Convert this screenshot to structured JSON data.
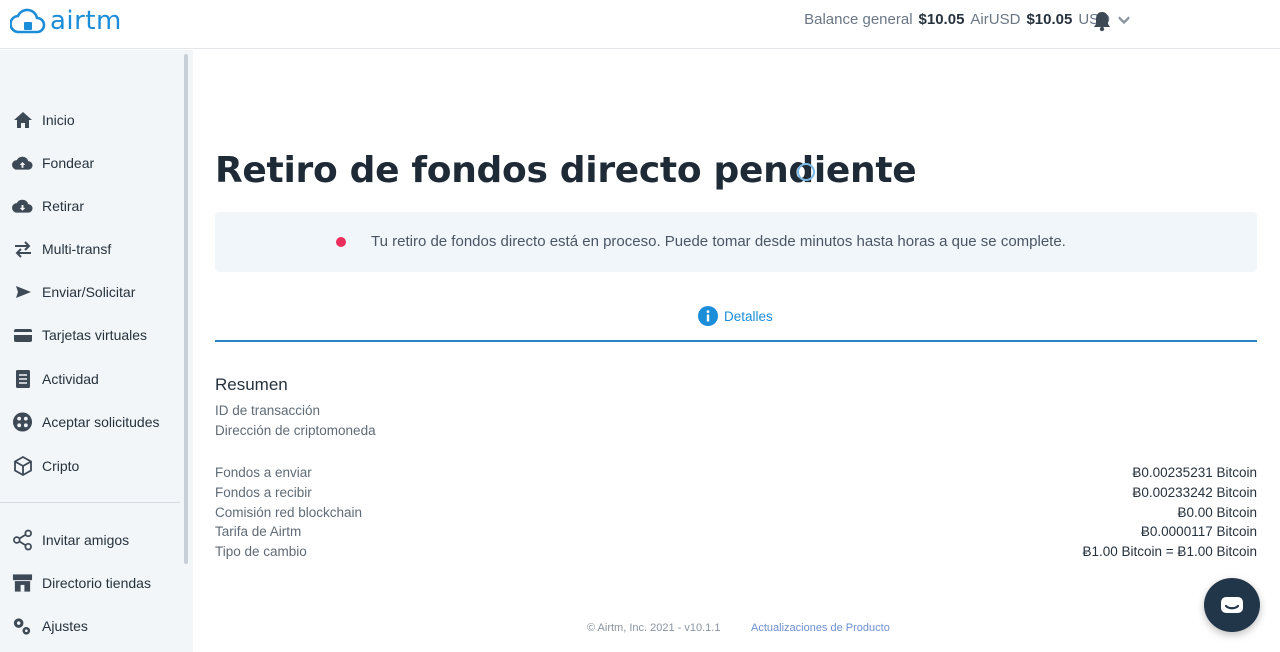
{
  "app": {
    "logo_text": "airtm"
  },
  "header": {
    "balance_label": "Balance general",
    "balance_airusd_value": "$10.05",
    "balance_airusd_unit": "AirUSD",
    "balance_usd_value": "$10.05",
    "balance_usd_unit": "USD"
  },
  "sidebar": {
    "items": [
      {
        "label": "Inicio",
        "icon": "home-icon"
      },
      {
        "label": "Fondear",
        "icon": "cloud-upload-icon"
      },
      {
        "label": "Retirar",
        "icon": "cloud-download-icon"
      },
      {
        "label": "Multi-transf",
        "icon": "transfer-arrows-icon"
      },
      {
        "label": "Enviar/Solicitar",
        "icon": "send-icon"
      },
      {
        "label": "Tarjetas virtuales",
        "icon": "credit-card-icon"
      },
      {
        "label": "Actividad",
        "icon": "document-icon"
      },
      {
        "label": "Aceptar solicitudes",
        "icon": "requests-icon"
      },
      {
        "label": "Cripto",
        "icon": "cube-icon"
      }
    ],
    "bottom_items": [
      {
        "label": "Invitar amigos",
        "icon": "share-icon"
      },
      {
        "label": "Directorio tiendas",
        "icon": "store-icon"
      },
      {
        "label": "Ajustes",
        "icon": "gears-icon"
      }
    ]
  },
  "main": {
    "title": "Retiro de fondos directo pendiente",
    "alert_text": "Tu retiro de fondos directo está en proceso. Puede tomar desde minutos hasta horas a que se complete.",
    "tab_label": "Detalles",
    "summary": {
      "title": "Resumen",
      "id_label": "ID de transacción",
      "address_label": "Dirección de criptomoneda",
      "rows": [
        {
          "label": "Fondos a enviar",
          "value": "Ƀ0.00235231 Bitcoin"
        },
        {
          "label": "Fondos a recibir",
          "value": "Ƀ0.00233242 Bitcoin"
        },
        {
          "label": "Comisión red blockchain",
          "value": "Ƀ0.00 Bitcoin"
        },
        {
          "label": "Tarifa de Airtm",
          "value": "Ƀ0.0000117 Bitcoin"
        },
        {
          "label": "Tipo de cambio",
          "value": "Ƀ1.00 Bitcoin = Ƀ1.00 Bitcoin"
        }
      ]
    }
  },
  "footer": {
    "copyright": "© Airtm, Inc. 2021 - v10.1.1",
    "link": "Actualizaciones de Producto"
  },
  "colors": {
    "brand": "#1c8dd9",
    "status_dot": "#ea2e5b",
    "chat_button": "#22364a"
  }
}
